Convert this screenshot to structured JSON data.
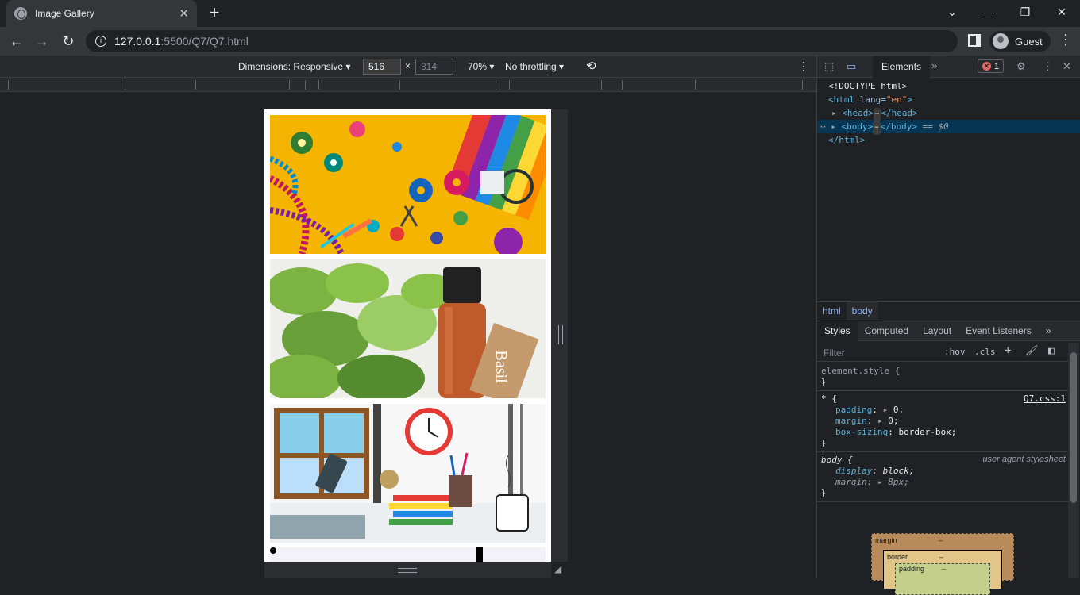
{
  "browser": {
    "tab_title": "Image Gallery",
    "url_host": "127.0.0.1",
    "url_path": ":5500/Q7/Q7.html",
    "profile_name": "Guest"
  },
  "device_toolbar": {
    "dimensions_label": "Dimensions: Responsive",
    "width": "516",
    "times": "×",
    "height": "814",
    "zoom": "70%",
    "throttling": "No throttling"
  },
  "page": {
    "images": [
      {
        "name": "craft-supplies-image",
        "alt": "Craft supplies"
      },
      {
        "name": "basil-oil-image",
        "alt": "Basil",
        "tag_text": "Basil"
      },
      {
        "name": "study-desk-image",
        "alt": "Study desk"
      }
    ]
  },
  "devtools": {
    "active_tab": "Elements",
    "error_count": "1",
    "dom": {
      "doctype": "<!DOCTYPE html>",
      "html_open_tag": "<html",
      "html_attr": " lang=",
      "html_attr_val": "\"en\"",
      "html_close_bracket": ">",
      "head_open": "<head>",
      "head_close": "</head>",
      "body_open": "<body>",
      "body_close": "</body>",
      "selected_marker": "== $0",
      "html_close": "</html>"
    },
    "breadcrumbs": [
      "html",
      "body"
    ],
    "style_tabs": [
      "Styles",
      "Computed",
      "Layout",
      "Event Listeners"
    ],
    "filter_placeholder": "Filter",
    "filter_options": [
      ":hov",
      ".cls",
      "+"
    ],
    "rules": {
      "element_style_selector": "element.style {",
      "close_brace": "}",
      "universal_selector": "* {",
      "universal_source": "Q7.css:1",
      "universal_props": [
        {
          "name": "padding",
          "value": "0;"
        },
        {
          "name": "margin",
          "value": "0;"
        },
        {
          "name": "box-sizing",
          "value": "border-box;"
        }
      ],
      "body_selector": "body {",
      "body_source": "user agent stylesheet",
      "body_display_name": "display",
      "body_display_value": "block;",
      "body_margin_name": "margin",
      "body_margin_value": "8px;"
    },
    "box_model": {
      "margin_label": "margin",
      "border_label": "border",
      "padding_label": "padding",
      "dash": "–"
    }
  }
}
